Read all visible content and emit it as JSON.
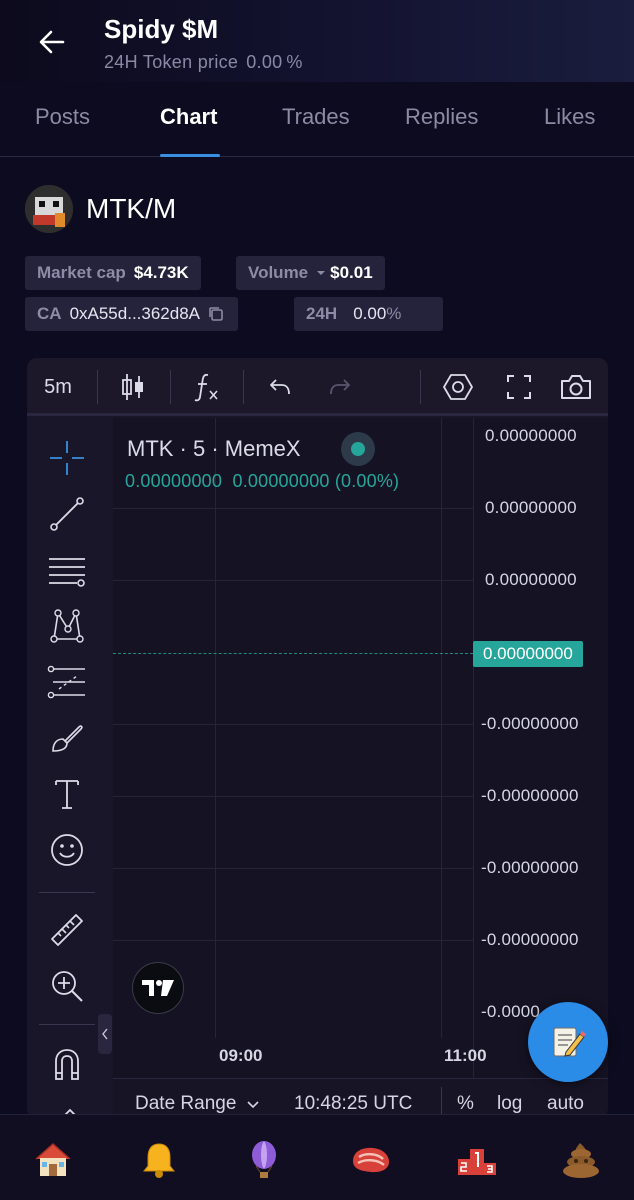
{
  "header": {
    "title": "Spidy $M",
    "subtitle_label": "24H Token price",
    "subtitle_value": "0.00 %"
  },
  "tabs": [
    {
      "label": "Posts",
      "active": false
    },
    {
      "label": "Chart",
      "active": true
    },
    {
      "label": "Trades",
      "active": false
    },
    {
      "label": "Replies",
      "active": false
    },
    {
      "label": "Likes",
      "active": false
    }
  ],
  "token": {
    "pair": "MTK/M",
    "market_cap_label": "Market cap",
    "market_cap_value": "$4.73K",
    "volume_label": "Volume",
    "volume_value": "$0.01",
    "ca_label": "CA",
    "ca_value": "0xA55d...362d8A",
    "h24_label": "24H",
    "h24_value": "0.00",
    "h24_unit": "%"
  },
  "chart_toolbar": {
    "interval": "5m"
  },
  "chart": {
    "legend_title": "MTK · 5 · MemeX",
    "legend_open": "0.00000000",
    "legend_close": "0.00000000",
    "legend_change": "(0.00%)",
    "price_labels": [
      "0.00000000",
      "0.00000000",
      "0.00000000",
      "-0.00000000",
      "-0.00000000",
      "-0.00000000",
      "-0.00000000",
      "-0.0000"
    ],
    "current_price": "0.00000000",
    "time_labels": [
      "09:00",
      "11:00"
    ],
    "bottom_bar": {
      "date_range": "Date Range",
      "clock": "10:48:25 UTC",
      "percent": "%",
      "log": "log",
      "auto": "auto"
    }
  },
  "colors": {
    "accent": "#3a8fe0",
    "up": "#26a69a",
    "fab": "#2b8ce8"
  }
}
